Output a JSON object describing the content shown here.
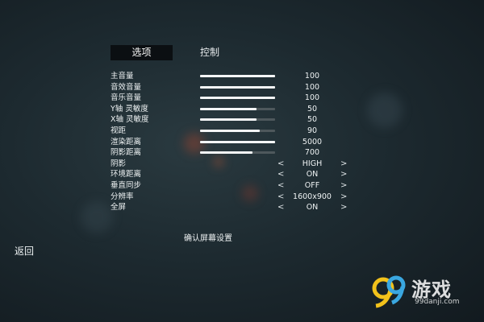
{
  "tabs": [
    {
      "label": "选项",
      "active": true
    },
    {
      "label": "控制",
      "active": false
    }
  ],
  "settings": [
    {
      "label": "主音量",
      "type": "slider",
      "value": "100",
      "level": 1.0
    },
    {
      "label": "音效音量",
      "type": "slider",
      "value": "100",
      "level": 1.0
    },
    {
      "label": "音乐音量",
      "type": "slider",
      "value": "100",
      "level": 1.0
    },
    {
      "label": "Y轴 灵敏度",
      "type": "slider",
      "value": "50",
      "level": 0.75
    },
    {
      "label": "X轴 灵敏度",
      "type": "slider",
      "value": "50",
      "level": 0.75
    },
    {
      "label": "视距",
      "type": "slider",
      "value": "90",
      "level": 0.8
    },
    {
      "label": "渲染距离",
      "type": "slider",
      "value": "5000",
      "level": 1.0
    },
    {
      "label": "阴影距离",
      "type": "slider",
      "value": "700",
      "level": 0.7
    },
    {
      "label": "阴影",
      "type": "select",
      "value": "HIGH",
      "prev": "<",
      "next": ">"
    },
    {
      "label": "环境距离",
      "type": "select",
      "value": "ON",
      "prev": "<",
      "next": ">"
    },
    {
      "label": "垂直同步",
      "type": "select",
      "value": "OFF",
      "prev": "<",
      "next": ">"
    },
    {
      "label": "分辨率",
      "type": "select",
      "value": "1600x900",
      "prev": "<",
      "next": ">"
    },
    {
      "label": "全屏",
      "type": "select",
      "value": "ON",
      "prev": "<",
      "next": ">"
    }
  ],
  "confirm_label": "确认屏幕设置",
  "back_label": "返回",
  "watermark": {
    "brand": "游戏",
    "url": "99danji.com",
    "logo": "99-logo-icon"
  },
  "colors": {
    "background": "#1d2a30",
    "slider_fill": "#f4f6f7",
    "slider_track": "#4e585c",
    "tab_active_bg": "#0b0f12"
  }
}
